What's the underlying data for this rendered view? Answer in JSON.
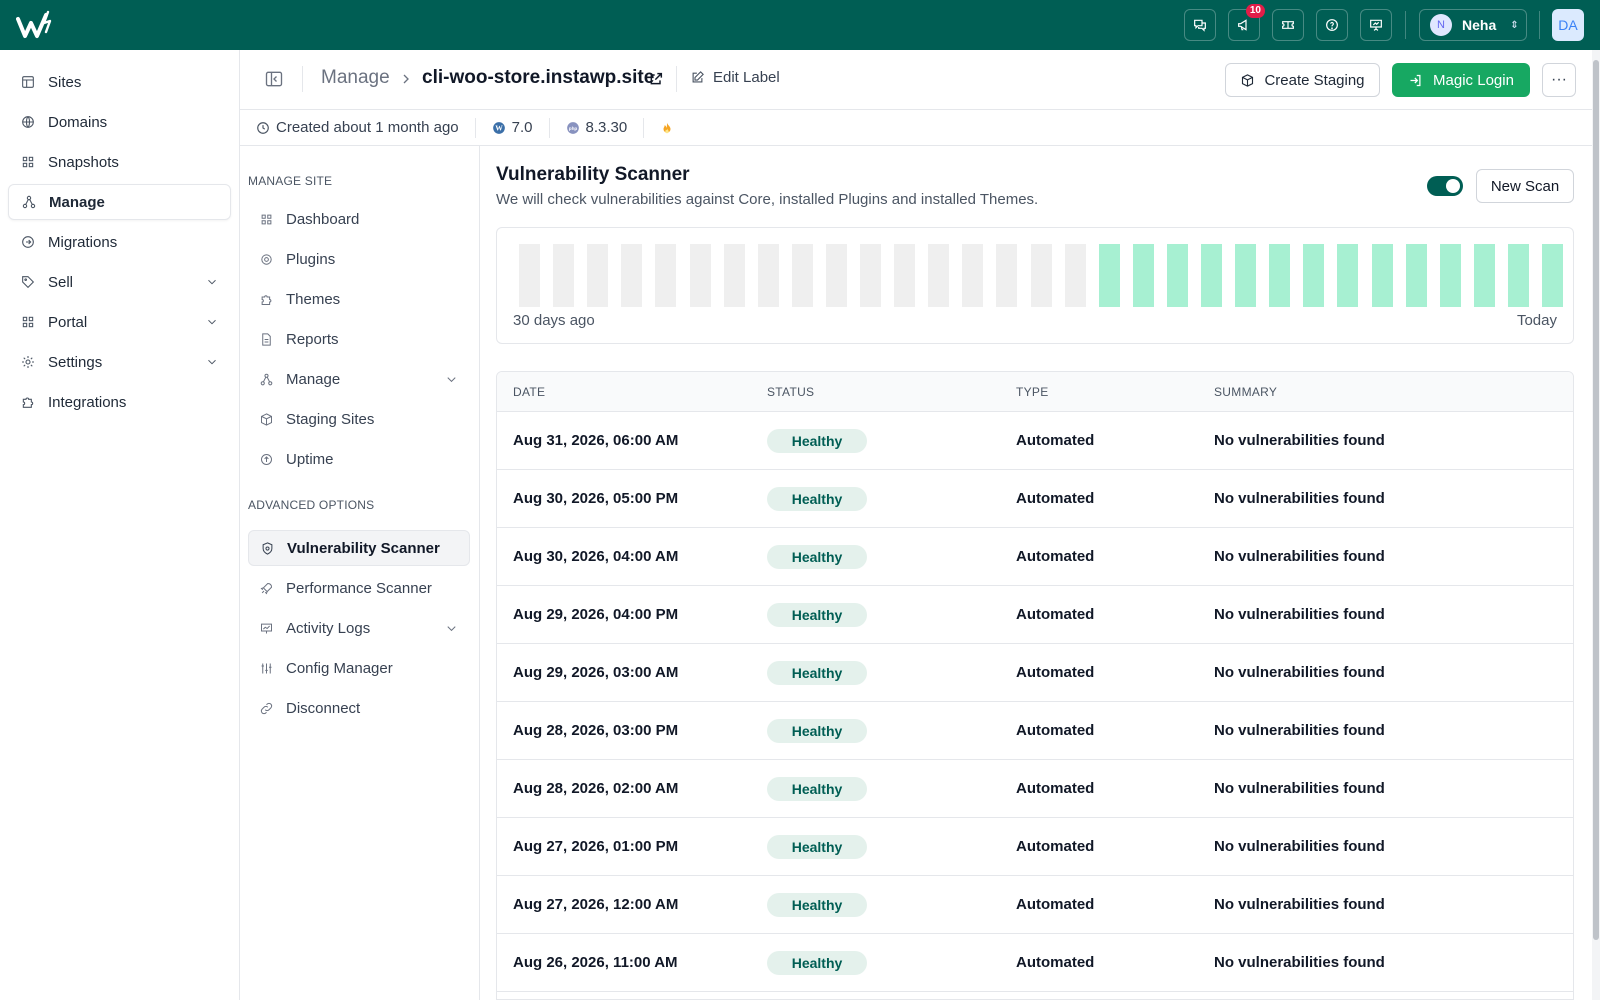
{
  "topbar": {
    "notification_count": "10",
    "user_initial": "N",
    "user_name": "Neha",
    "account_initials": "DA",
    "brand_color": "#005e54"
  },
  "sidebar": {
    "items": [
      {
        "label": "Sites",
        "icon": "table-icon"
      },
      {
        "label": "Domains",
        "icon": "globe-icon"
      },
      {
        "label": "Snapshots",
        "icon": "grid-icon"
      },
      {
        "label": "Manage",
        "icon": "nodes-icon",
        "active": true
      },
      {
        "label": "Migrations",
        "icon": "arrow-circle-icon"
      },
      {
        "label": "Sell",
        "icon": "tag-icon",
        "expandable": true
      },
      {
        "label": "Portal",
        "icon": "grid-icon",
        "expandable": true
      },
      {
        "label": "Settings",
        "icon": "gear-icon",
        "expandable": true
      },
      {
        "label": "Integrations",
        "icon": "puzzle-icon"
      }
    ]
  },
  "header": {
    "breadcrumb_root": "Manage",
    "site_name": "cli-woo-store.instawp.site",
    "edit_label": "Edit Label",
    "create_staging": "Create Staging",
    "magic_login": "Magic Login",
    "more": "···"
  },
  "meta": {
    "created": "Created about 1 month ago",
    "wp_version": "7.0",
    "php_version": "8.3.30"
  },
  "subnav": {
    "manage_heading": "MANAGE SITE",
    "advanced_heading": "ADVANCED OPTIONS",
    "items": [
      {
        "label": "Dashboard"
      },
      {
        "label": "Plugins"
      },
      {
        "label": "Themes"
      },
      {
        "label": "Reports"
      },
      {
        "label": "Manage"
      },
      {
        "label": "Staging Sites"
      },
      {
        "label": "Uptime"
      },
      {
        "label": "Vulnerability Scanner"
      },
      {
        "label": "Performance Scanner"
      },
      {
        "label": "Activity Logs"
      },
      {
        "label": "Config Manager"
      },
      {
        "label": "Disconnect"
      }
    ]
  },
  "scanner": {
    "title": "Vulnerability Scanner",
    "description": "We will check vulnerabilities against Core, installed Plugins and installed Themes.",
    "toggle_on": true,
    "new_scan": "New Scan",
    "history_left": "30 days ago",
    "history_right": "Today",
    "history_days": [
      "none",
      "none",
      "none",
      "none",
      "none",
      "none",
      "none",
      "none",
      "none",
      "none",
      "none",
      "none",
      "none",
      "none",
      "none",
      "none",
      "none",
      "healthy",
      "healthy",
      "healthy",
      "healthy",
      "healthy",
      "healthy",
      "healthy",
      "healthy",
      "healthy",
      "healthy",
      "healthy",
      "healthy",
      "healthy",
      "healthy"
    ],
    "history_colors": {
      "none": "#efefef",
      "healthy": "#a7f0d2"
    }
  },
  "table": {
    "headers": {
      "date": "DATE",
      "status": "STATUS",
      "type": "TYPE",
      "summary": "SUMMARY"
    },
    "rows": [
      {
        "date": "Aug 31, 2026, 06:00 AM",
        "status": "Healthy",
        "type": "Automated",
        "summary": "No vulnerabilities found"
      },
      {
        "date": "Aug 30, 2026, 05:00 PM",
        "status": "Healthy",
        "type": "Automated",
        "summary": "No vulnerabilities found"
      },
      {
        "date": "Aug 30, 2026, 04:00 AM",
        "status": "Healthy",
        "type": "Automated",
        "summary": "No vulnerabilities found"
      },
      {
        "date": "Aug 29, 2026, 04:00 PM",
        "status": "Healthy",
        "type": "Automated",
        "summary": "No vulnerabilities found"
      },
      {
        "date": "Aug 29, 2026, 03:00 AM",
        "status": "Healthy",
        "type": "Automated",
        "summary": "No vulnerabilities found"
      },
      {
        "date": "Aug 28, 2026, 03:00 PM",
        "status": "Healthy",
        "type": "Automated",
        "summary": "No vulnerabilities found"
      },
      {
        "date": "Aug 28, 2026, 02:00 AM",
        "status": "Healthy",
        "type": "Automated",
        "summary": "No vulnerabilities found"
      },
      {
        "date": "Aug 27, 2026, 01:00 PM",
        "status": "Healthy",
        "type": "Automated",
        "summary": "No vulnerabilities found"
      },
      {
        "date": "Aug 27, 2026, 12:00 AM",
        "status": "Healthy",
        "type": "Automated",
        "summary": "No vulnerabilities found"
      },
      {
        "date": "Aug 26, 2026, 11:00 AM",
        "status": "Healthy",
        "type": "Automated",
        "summary": "No vulnerabilities found"
      }
    ]
  }
}
